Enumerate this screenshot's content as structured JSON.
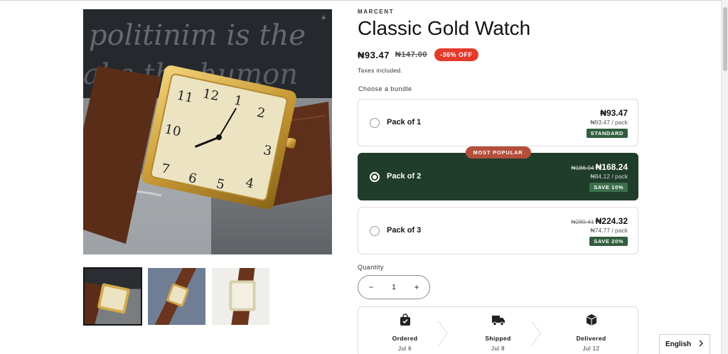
{
  "product": {
    "vendor": "MARCENT",
    "title": "Classic Gold Watch",
    "price": "₦93.47",
    "compare_price": "₦147.00",
    "sale_badge": "-36% OFF",
    "taxes_note": "Taxes included."
  },
  "gallery": {
    "main_image_alt": "Gold rectangular watch with brown leather strap",
    "thumbnails": [
      "thumbnail-1",
      "thumbnail-2",
      "thumbnail-3"
    ],
    "active_thumbnail": 0
  },
  "bundle": {
    "label": "Choose a bundle",
    "options": [
      {
        "name": "Pack of 1",
        "price": "₦93.47",
        "old_price": "",
        "per_pack": "₦93.47 / pack",
        "tag": "STANDARD",
        "selected": false
      },
      {
        "name": "Pack of 2",
        "price": "₦168.24",
        "old_price": "₦186.94",
        "per_pack": "₦84.12 / pack",
        "tag": "SAVE 10%",
        "selected": true,
        "ribbon": "MOST POPULAR"
      },
      {
        "name": "Pack of 3",
        "price": "₦224.32",
        "old_price": "₦280.41",
        "per_pack": "₦74.77 / pack",
        "tag": "SAVE 20%",
        "selected": false
      }
    ]
  },
  "quantity": {
    "label": "Quantity",
    "value": "1",
    "minus": "−",
    "plus": "+"
  },
  "timeline": [
    {
      "name": "Ordered",
      "date": "Jul 6",
      "icon": "shopping-bag-check-icon"
    },
    {
      "name": "Shipped",
      "date": "Jul 8",
      "icon": "truck-icon"
    },
    {
      "name": "Delivered",
      "date": "Jul 12",
      "icon": "package-icon"
    }
  ],
  "language_selector": {
    "label": "English",
    "icon": "chevron-right-icon"
  },
  "colors": {
    "selected_bundle": "#203c2b",
    "sale_badge": "#e53a2b",
    "popular_ribbon": "#b44f3b",
    "tag": "#325e3f"
  }
}
